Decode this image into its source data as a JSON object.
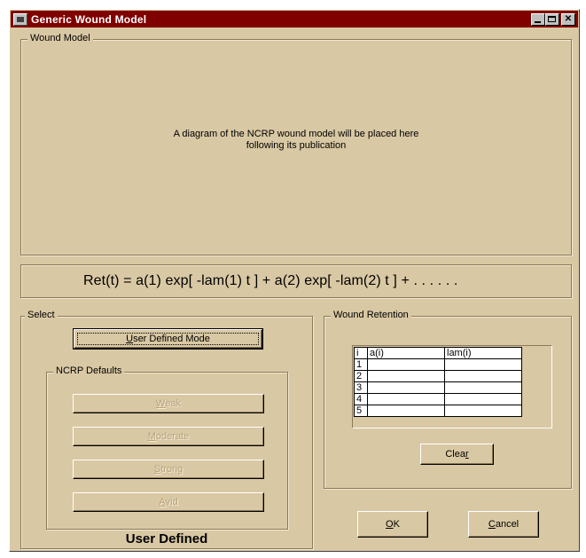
{
  "window": {
    "title": "Generic Wound Model",
    "colors": {
      "titlebar": "#800000",
      "face": "#d9c8a4"
    }
  },
  "wound_model": {
    "label": "Wound Model",
    "diagram_text_line1": "A diagram of the NCRP wound model will be placed here",
    "diagram_text_line2": "following its publication"
  },
  "formula": "Ret(t) = a(1) exp[ -lam(1) t ]  + a(2) exp[ -lam(2) t ]  + . . . . . .",
  "select": {
    "label": "Select",
    "user_defined_button": {
      "mnemonic": "U",
      "rest": "ser Defined Mode"
    },
    "ncrp_defaults": {
      "label": "NCRP Defaults",
      "buttons": [
        {
          "mnemonic": "W",
          "rest": "eak"
        },
        {
          "mnemonic": "M",
          "rest": "oderate"
        },
        {
          "mnemonic": "S",
          "rest": "trong"
        },
        {
          "mnemonic": "A",
          "rest": "vid"
        }
      ]
    },
    "status": "User Defined"
  },
  "retention": {
    "label": "Wound Retention",
    "headers": {
      "index": "i",
      "a": "a(i)",
      "lam": "lam(i)"
    },
    "rows": [
      {
        "i": "1",
        "a": "",
        "lam": ""
      },
      {
        "i": "2",
        "a": "",
        "lam": ""
      },
      {
        "i": "3",
        "a": "",
        "lam": ""
      },
      {
        "i": "4",
        "a": "",
        "lam": ""
      },
      {
        "i": "5",
        "a": "",
        "lam": ""
      }
    ],
    "clear_button": {
      "before": "Clea",
      "mnemonic": "r"
    }
  },
  "actions": {
    "ok": {
      "mnemonic": "O",
      "rest": "K"
    },
    "cancel": {
      "mnemonic": "C",
      "rest": "ancel"
    }
  }
}
